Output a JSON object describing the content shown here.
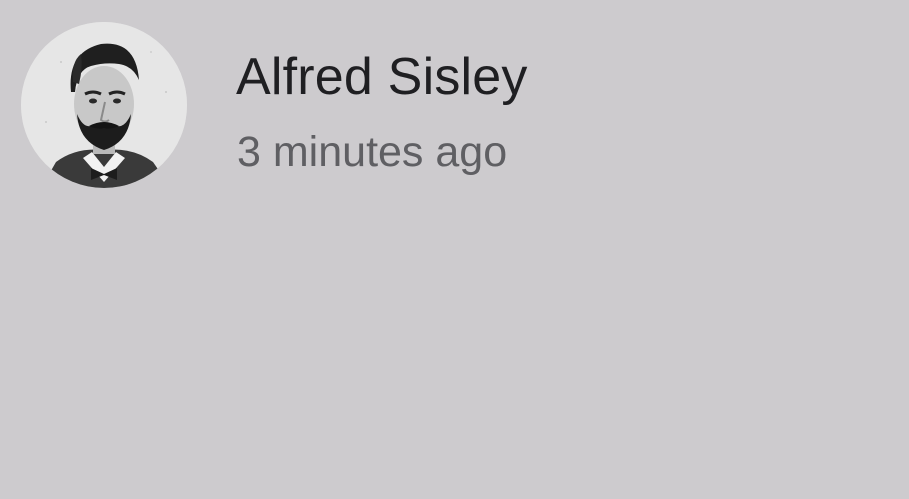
{
  "post_header": {
    "author_name": "Alfred Sisley",
    "timestamp": "3 minutes ago",
    "avatar_icon": "portrait-avatar"
  }
}
